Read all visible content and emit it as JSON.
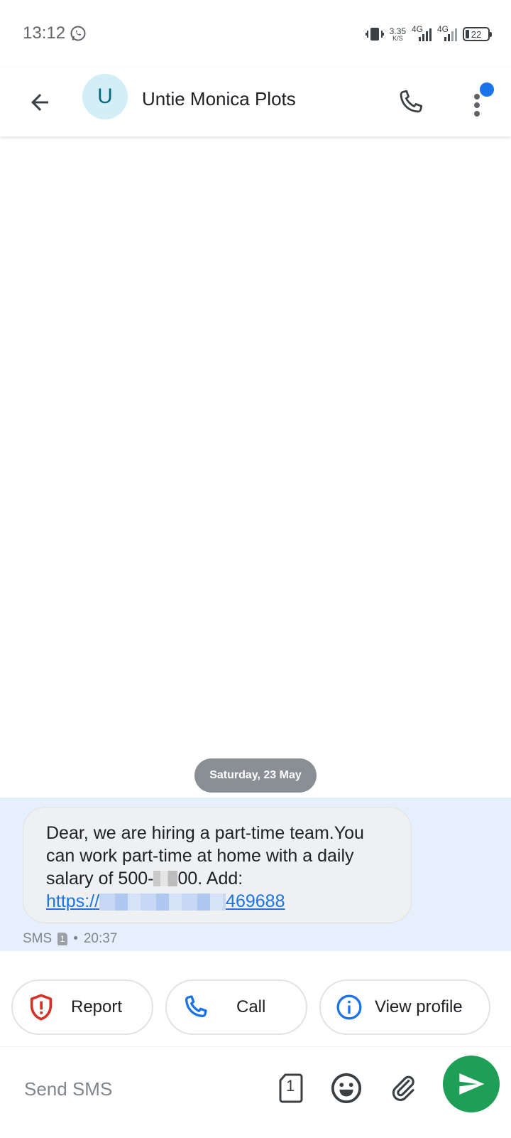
{
  "status_bar": {
    "time": "13:12",
    "net_speed_value": "3.35",
    "net_speed_unit": "K/S",
    "network_1": "4G",
    "network_2": "4G",
    "battery": "22",
    "icons": [
      "whatsapp-icon",
      "vibrate-icon",
      "signal-icon",
      "battery-icon"
    ]
  },
  "header": {
    "avatar_initial": "U",
    "contact_name": "Untie Monica Plots",
    "icons": [
      "back-arrow-icon",
      "phone-icon",
      "more-vert-icon"
    ],
    "accent_color": "#1a73e8"
  },
  "conversation": {
    "date_chip": "Saturday, 23 May",
    "message": {
      "text": "Dear, we are hiring a part-time team.You can work part-time at home with a daily salary of 500-",
      "text_tail": "00. Add:",
      "link_prefix": "https://",
      "link_suffix": "469688",
      "meta_type": "SMS",
      "sim_slot": "1",
      "time": "20:37"
    }
  },
  "actions": {
    "report_label": "Report",
    "call_label": "Call",
    "profile_label": "View profile",
    "report_color": "#d93025",
    "call_color": "#1a73e8"
  },
  "composer": {
    "placeholder": "Send SMS",
    "sim_slot": "1",
    "send_color": "#1e9e57"
  }
}
